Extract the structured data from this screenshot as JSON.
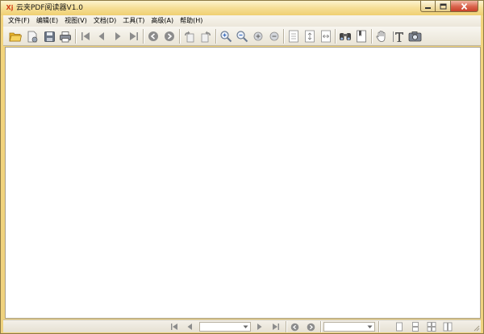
{
  "window": {
    "title": "云夹PDF阅读器V1.0",
    "app_icon_text": "Xj"
  },
  "menu": {
    "items": [
      {
        "label": "文件(F)"
      },
      {
        "label": "编辑(E)"
      },
      {
        "label": "视图(V)"
      },
      {
        "label": "文档(D)"
      },
      {
        "label": "工具(T)"
      },
      {
        "label": "高级(A)"
      },
      {
        "label": "帮助(H)"
      }
    ]
  },
  "toolbar": {
    "icons": [
      "open-folder-icon",
      "document-properties-icon",
      "save-icon",
      "print-icon",
      "first-page-icon",
      "previous-page-icon",
      "next-page-icon",
      "last-page-icon",
      "go-back-icon",
      "go-forward-icon",
      "rotate-left-icon",
      "rotate-right-icon",
      "zoom-in-icon",
      "zoom-out-icon",
      "zoom-in-small-icon",
      "zoom-out-small-icon",
      "actual-size-icon",
      "fit-page-icon",
      "fit-width-icon",
      "find-icon",
      "bookmark-page-icon",
      "hand-tool-icon",
      "text-select-icon",
      "snapshot-icon"
    ]
  },
  "statusbar": {
    "page_input_value": "",
    "zoom_input_value": ""
  },
  "colors": {
    "title_gradient_top": "#fdf3cf",
    "title_gradient_bottom": "#efcf72",
    "close_button": "#c8412a",
    "accent_blue": "#3c6fbf",
    "folder_yellow": "#e9b52a"
  }
}
